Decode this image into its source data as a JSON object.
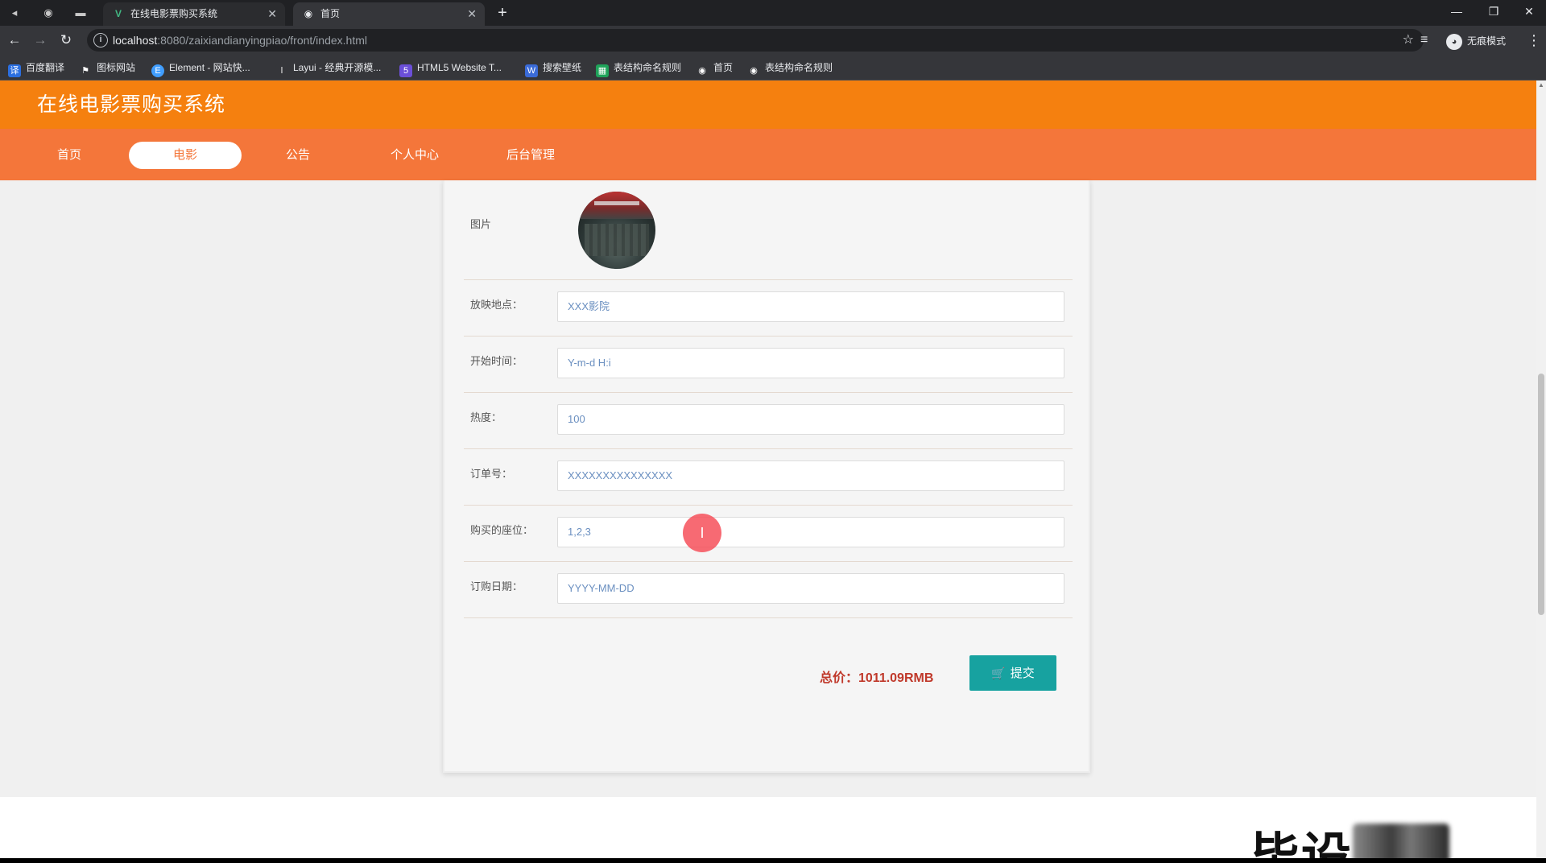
{
  "browser": {
    "tabs": [
      {
        "title": "在线电影票购买系统",
        "active": false,
        "favicon": "vue-icon"
      },
      {
        "title": "首页",
        "active": true,
        "favicon": "globe-icon"
      }
    ],
    "url_host": "localhost",
    "url_rest": ":8080/zaixiandianyingpiao/front/index.html",
    "incognito_label": "无痕模式",
    "bookmarks": [
      {
        "label": "百度翻译",
        "icon": "translate-icon",
        "color": "#2b6fe0"
      },
      {
        "label": "图标网站",
        "icon": "flag-icon",
        "color": "#444"
      },
      {
        "label": "Element - 网站快...",
        "icon": "element-icon",
        "color": "#409eff"
      },
      {
        "label": "Layui - 经典开源模...",
        "icon": "layui-icon",
        "color": "#555"
      },
      {
        "label": "HTML5 Website T...",
        "icon": "html5-icon",
        "color": "#6b4fd8"
      },
      {
        "label": "搜索壁纸",
        "icon": "wallpaper-icon",
        "color": "#3a6bd8"
      },
      {
        "label": "表结构命名规则",
        "icon": "table-icon",
        "color": "#1fa35a"
      },
      {
        "label": "首页",
        "icon": "globe-icon",
        "color": "#777"
      },
      {
        "label": "表结构命名规则",
        "icon": "globe-icon",
        "color": "#777"
      }
    ]
  },
  "site": {
    "title": "在线电影票购买系统",
    "nav": [
      {
        "label": "首页",
        "active": false
      },
      {
        "label": "电影",
        "active": true
      },
      {
        "label": "公告",
        "active": false
      },
      {
        "label": "个人中心",
        "active": false
      },
      {
        "label": "后台管理",
        "active": false
      }
    ]
  },
  "form": {
    "picture_label": "图片",
    "fields": [
      {
        "label": "放映地点：",
        "value": "XXX影院"
      },
      {
        "label": "开始时间：",
        "value": "Y-m-d H:i"
      },
      {
        "label": "热度：",
        "value": "100"
      },
      {
        "label": "订单号：",
        "value": "XXXXXXXXXXXXXXX"
      },
      {
        "label": "购买的座位：",
        "value": "1,2,3"
      },
      {
        "label": "订购日期：",
        "value": "YYYY-MM-DD"
      }
    ],
    "total": "总价：1011.09RMB",
    "submit_label": "提交"
  },
  "cursor_glyph": "I",
  "watermark": "毕设",
  "colors": {
    "header_orange": "#f5800f",
    "nav_orange": "#f4763a",
    "submit_teal": "#17a2a0",
    "total_red": "#c0392b"
  }
}
